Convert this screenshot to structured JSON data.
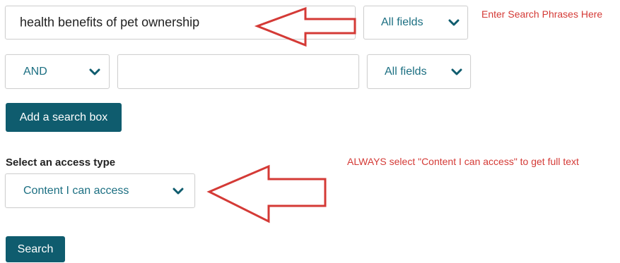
{
  "row1": {
    "query": "health benefits of pet ownership",
    "field_select": "All fields"
  },
  "row2": {
    "operator": "AND",
    "query": "",
    "field_select": "All fields"
  },
  "add_box_button": "Add a search box",
  "access": {
    "heading": "Select an access type",
    "selected": "Content I can access"
  },
  "search_button": "Search",
  "annotations": {
    "search_note": "Enter Search Phrases Here",
    "access_note": "ALWAYS select \"Content I can access\" to get full text",
    "color": "#d43a36"
  },
  "colors": {
    "button_bg": "#0f5c6e",
    "select_text": "#1c6f82"
  },
  "icons": [
    "chevron-down-icon",
    "arrow-left-annotation"
  ]
}
